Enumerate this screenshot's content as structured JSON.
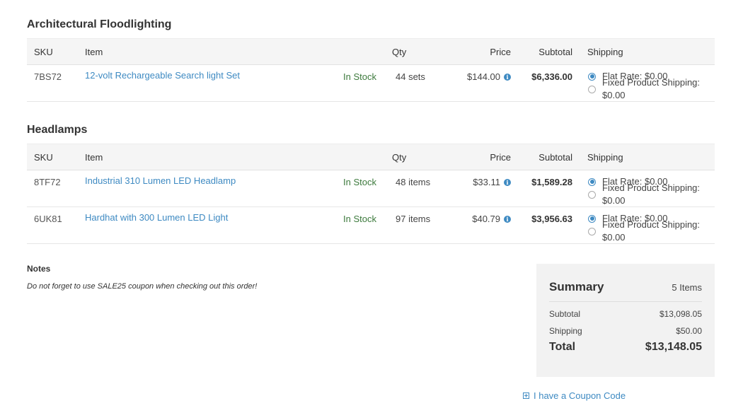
{
  "columns": {
    "sku": "SKU",
    "item": "Item",
    "qty": "Qty",
    "price": "Price",
    "subtotal": "Subtotal",
    "shipping": "Shipping"
  },
  "sections": [
    {
      "title": "Architectural Floodlighting",
      "rows": [
        {
          "sku": "7BS72",
          "item": "12-volt Rechargeable Search light Set",
          "stock": "In Stock",
          "qty": "44 sets",
          "price": "$144.00",
          "subtotal": "$6,336.00",
          "shipping": [
            "Flat Rate: $0.00",
            "Fixed Product Shipping: $0.00"
          ]
        }
      ]
    },
    {
      "title": "Headlamps",
      "rows": [
        {
          "sku": "8TF72",
          "item": "Industrial 310 Lumen LED Headlamp",
          "stock": "In Stock",
          "qty": "48 items",
          "price": "$33.11",
          "subtotal": "$1,589.28",
          "shipping": [
            "Flat Rate: $0.00",
            "Fixed Product Shipping: $0.00"
          ]
        },
        {
          "sku": "6UK81",
          "item": "Hardhat with 300 Lumen LED Light",
          "stock": "In Stock",
          "qty": "97 items",
          "price": "$40.79",
          "subtotal": "$3,956.63",
          "shipping": [
            "Flat Rate: $0.00",
            "Fixed Product Shipping: $0.00"
          ]
        }
      ]
    }
  ],
  "notes": {
    "label": "Notes",
    "text": "Do not forget to use SALE25 coupon when checking out this order!"
  },
  "summary": {
    "title": "Summary",
    "count": "5 Items",
    "subtotal_label": "Subtotal",
    "subtotal_value": "$13,098.05",
    "shipping_label": "Shipping",
    "shipping_value": "$50.00",
    "total_label": "Total",
    "total_value": "$13,148.05"
  },
  "coupon": {
    "label": "I have a Coupon Code"
  },
  "colors": {
    "link": "#3e8ac2",
    "in_stock": "#3d7a3d",
    "summary_bg": "#f2f2f2",
    "header_bg": "#f5f5f5"
  }
}
